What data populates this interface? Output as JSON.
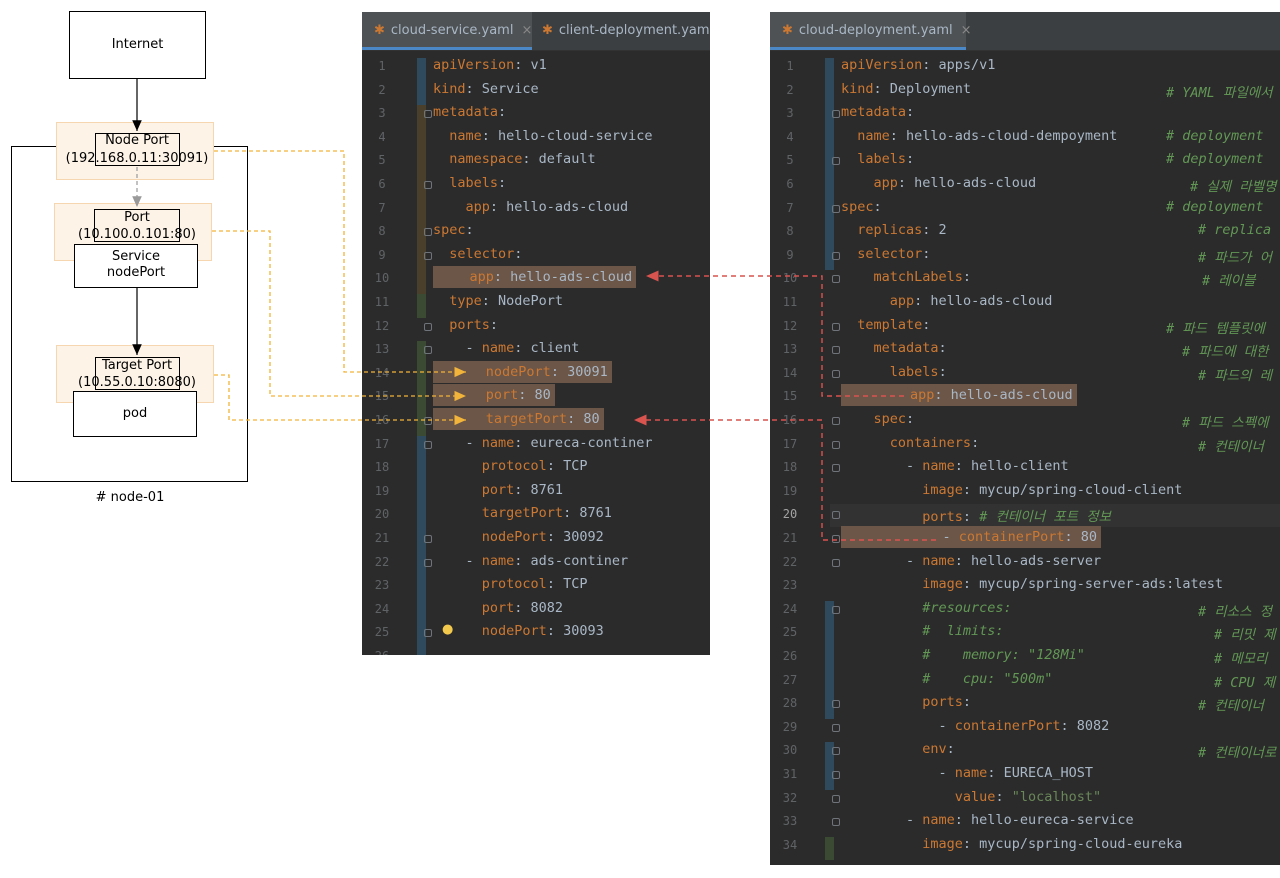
{
  "diagram": {
    "internet": "Internet",
    "node_port_title": "Node Port",
    "node_port_addr": "(192.168.0.11:30091)",
    "port_title": "Port",
    "port_addr": "(10.100.0.101:80)",
    "service_title": "Service",
    "service_sub": "nodePort",
    "target_port_title": "Target Port",
    "target_port_addr": "(10.55.0.10:8080)",
    "pod": "pod",
    "node_caption": "# node-01"
  },
  "left_editor": {
    "tabs": [
      {
        "label": "cloud-service.yaml",
        "close": "×",
        "active": true
      },
      {
        "label": "client-deployment.yaml",
        "close": "×",
        "active": false
      }
    ],
    "lines": [
      {
        "n": "1",
        "c": "apiVersion: v1"
      },
      {
        "n": "2",
        "c": "kind: Service"
      },
      {
        "n": "3",
        "c": "metadata:"
      },
      {
        "n": "4",
        "c": "  name: hello-cloud-service"
      },
      {
        "n": "5",
        "c": "  namespace: default"
      },
      {
        "n": "6",
        "c": "  labels:"
      },
      {
        "n": "7",
        "c": "    app: hello-ads-cloud"
      },
      {
        "n": "8",
        "c": "spec:"
      },
      {
        "n": "9",
        "c": "  selector:"
      },
      {
        "n": "10",
        "c": "    app: hello-ads-cloud"
      },
      {
        "n": "11",
        "c": "  type: NodePort"
      },
      {
        "n": "12",
        "c": "  ports:"
      },
      {
        "n": "13",
        "c": "    - name: client"
      },
      {
        "n": "14",
        "c": "      nodePort: 30091"
      },
      {
        "n": "15",
        "c": "      port: 80"
      },
      {
        "n": "16",
        "c": "      targetPort: 80"
      },
      {
        "n": "17",
        "c": "    - name: eureca-continer"
      },
      {
        "n": "18",
        "c": "      protocol: TCP"
      },
      {
        "n": "19",
        "c": "      port: 8761"
      },
      {
        "n": "20",
        "c": "      targetPort: 8761"
      },
      {
        "n": "21",
        "c": "      nodePort: 30092"
      },
      {
        "n": "22",
        "c": "    - name: ads-continer"
      },
      {
        "n": "23",
        "c": "      protocol: TCP"
      },
      {
        "n": "24",
        "c": "      port: 8082"
      },
      {
        "n": "25",
        "c": "      nodePort: 30093"
      },
      {
        "n": "26",
        "c": ""
      }
    ]
  },
  "right_editor": {
    "tabs": [
      {
        "label": "cloud-deployment.yaml",
        "close": "×",
        "active": true
      }
    ],
    "lines": [
      {
        "n": "1",
        "c": "apiVersion: apps/v1",
        "cm": ""
      },
      {
        "n": "2",
        "c": "kind: Deployment",
        "cm": "# YAML 파일에서"
      },
      {
        "n": "3",
        "c": "metadata:",
        "cm": ""
      },
      {
        "n": "4",
        "c": "  name: hello-ads-cloud-dempoyment",
        "cm": "# deployment"
      },
      {
        "n": "5",
        "c": "  labels:",
        "cm": "# deployment"
      },
      {
        "n": "6",
        "c": "    app: hello-ads-cloud",
        "cm": "# 실제 라벨명"
      },
      {
        "n": "7",
        "c": "spec:",
        "cm": "# deployment"
      },
      {
        "n": "8",
        "c": "  replicas: 2",
        "cm": "# replica"
      },
      {
        "n": "9",
        "c": "  selector:",
        "cm": "# 파드가 어"
      },
      {
        "n": "10",
        "c": "    matchLabels:",
        "cm": "# 레이블"
      },
      {
        "n": "11",
        "c": "      app: hello-ads-cloud",
        "cm": ""
      },
      {
        "n": "12",
        "c": "  template:",
        "cm": "# 파드 템플릿에"
      },
      {
        "n": "13",
        "c": "    metadata:",
        "cm": "# 파드에 대한"
      },
      {
        "n": "14",
        "c": "      labels:",
        "cm": "# 파드의 레"
      },
      {
        "n": "15",
        "c": "        app: hello-ads-cloud",
        "cm": ""
      },
      {
        "n": "16",
        "c": "    spec:",
        "cm": "# 파드 스펙에"
      },
      {
        "n": "17",
        "c": "      containers:",
        "cm": "# 컨테이너"
      },
      {
        "n": "18",
        "c": "        - name: hello-client",
        "cm": ""
      },
      {
        "n": "19",
        "c": "          image: mycup/spring-cloud-client",
        "cm": ""
      },
      {
        "n": "20",
        "c": "          ports: # 컨테이너 포트 정보",
        "cm": ""
      },
      {
        "n": "21",
        "c": "            - containerPort: 80",
        "cm": ""
      },
      {
        "n": "22",
        "c": "        - name: hello-ads-server",
        "cm": ""
      },
      {
        "n": "23",
        "c": "          image: mycup/spring-server-ads:latest",
        "cm": ""
      },
      {
        "n": "24",
        "c": "          #resources:",
        "cm": "# 리소스 정"
      },
      {
        "n": "25",
        "c": "          #  limits:",
        "cm": "# 리밋 제"
      },
      {
        "n": "26",
        "c": "          #    memory: \"128Mi\"",
        "cm": "# 메모리"
      },
      {
        "n": "27",
        "c": "          #    cpu: \"500m\"",
        "cm": "# CPU 제"
      },
      {
        "n": "28",
        "c": "          ports:",
        "cm": "# 컨테이너"
      },
      {
        "n": "29",
        "c": "            - containerPort: 8082",
        "cm": ""
      },
      {
        "n": "30",
        "c": "          env:",
        "cm": "# 컨테이너로"
      },
      {
        "n": "31",
        "c": "            - name: EURECA_HOST",
        "cm": ""
      },
      {
        "n": "32",
        "c": "              value: \"localhost\"",
        "cm": ""
      },
      {
        "n": "33",
        "c": "        - name: hello-eureca-service",
        "cm": ""
      },
      {
        "n": "34",
        "c": "          image: mycup/spring-cloud-eureka",
        "cm": ""
      }
    ]
  },
  "colors": {
    "editor_bg": "#2b2b2b",
    "key": "#cc7832",
    "string": "#6a8759",
    "comment": "#629755",
    "orange_arrow": "#f2b43a",
    "red_arrow": "#d9534f"
  }
}
